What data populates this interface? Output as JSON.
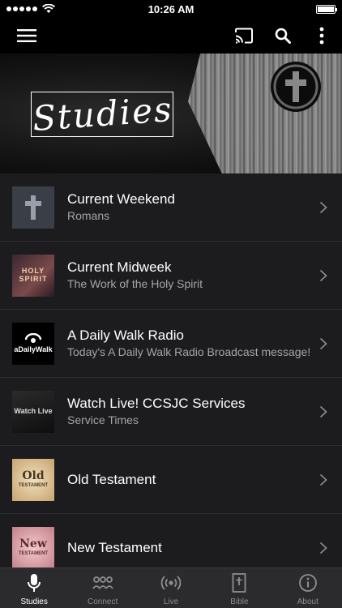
{
  "status_bar": {
    "time": "10:26 AM"
  },
  "banner": {
    "title": "Studies"
  },
  "list": [
    {
      "title": "Current Weekend",
      "subtitle": "Romans",
      "thumb": "cross"
    },
    {
      "title": "Current Midweek",
      "subtitle": "The Work of the Holy Spirit",
      "thumb": "HOLY SPIRIT"
    },
    {
      "title": "A Daily Walk Radio",
      "subtitle": "Today's A Daily Walk Radio Broadcast message!",
      "thumb": "aDailyWalk"
    },
    {
      "title": "Watch Live! CCSJC Services",
      "subtitle": "Service Times",
      "thumb": "Watch Live"
    },
    {
      "title": "Old Testament",
      "subtitle": "",
      "thumb_word": "Old",
      "thumb_sub": "TESTAMENT"
    },
    {
      "title": "New Testament",
      "subtitle": "",
      "thumb_word": "New",
      "thumb_sub": "TESTAMENT"
    }
  ],
  "tabs": [
    {
      "label": "Studies",
      "icon": "microphone-icon",
      "active": true
    },
    {
      "label": "Connect",
      "icon": "people-icon",
      "active": false
    },
    {
      "label": "Live",
      "icon": "broadcast-icon",
      "active": false
    },
    {
      "label": "Bible",
      "icon": "bible-icon",
      "active": false
    },
    {
      "label": "About",
      "icon": "info-icon",
      "active": false
    }
  ],
  "colors": {
    "background": "#1c1c1e",
    "tab_bar": "#2b2b2d",
    "subtitle": "#a5a5aa",
    "tab_inactive": "#8e8e93"
  }
}
